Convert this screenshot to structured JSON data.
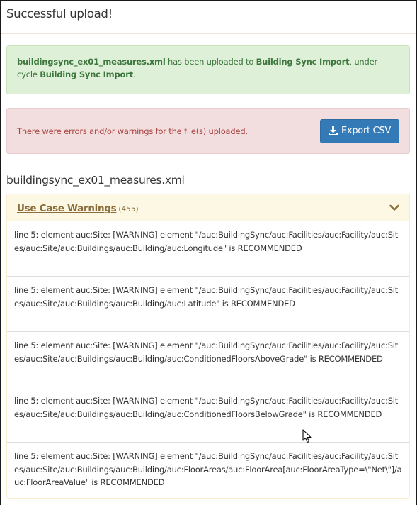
{
  "header": {
    "title": "Successful upload!"
  },
  "success_alert": {
    "file": "buildingsync_ex01_measures.xml",
    "text1": " has been uploaded to ",
    "dataset": "Building Sync Import",
    "text2": ", under cycle ",
    "cycle": "Building Sync Import",
    "text3": "."
  },
  "error_alert": {
    "message": "There were errors and/or warnings for the file(s) uploaded.",
    "export_label": "Export CSV"
  },
  "file_heading": "buildingsync_ex01_measures.xml",
  "panel": {
    "title": "Use Case Warnings",
    "count": "(455)",
    "warnings": [
      "line 5: element auc:Site: [WARNING] element \"/auc:BuildingSync/auc:Facilities/auc:Facility/auc:Sites/auc:Site/auc:Buildings/auc:Building/auc:Longitude\" is RECOMMENDED",
      "line 5: element auc:Site: [WARNING] element \"/auc:BuildingSync/auc:Facilities/auc:Facility/auc:Sites/auc:Site/auc:Buildings/auc:Building/auc:Latitude\" is RECOMMENDED",
      "line 5: element auc:Site: [WARNING] element \"/auc:BuildingSync/auc:Facilities/auc:Facility/auc:Sites/auc:Site/auc:Buildings/auc:Building/auc:ConditionedFloorsAboveGrade\" is RECOMMENDED",
      "line 5: element auc:Site: [WARNING] element \"/auc:BuildingSync/auc:Facilities/auc:Facility/auc:Sites/auc:Site/auc:Buildings/auc:Building/auc:ConditionedFloorsBelowGrade\" is RECOMMENDED",
      "line 5: element auc:Site: [WARNING] element \"/auc:BuildingSync/auc:Facilities/auc:Facility/auc:Sites/auc:Site/auc:Buildings/auc:Building/auc:FloorAreas/auc:FloorArea[auc:FloorAreaType=\\\"Net\\\"]/auc:FloorAreaValue\" is RECOMMENDED"
    ]
  },
  "icons": {
    "export": "download-icon",
    "toggle": "chevron-down-icon",
    "pointer": "mouse-cursor-icon"
  },
  "colors": {
    "success_bg": "#dff0d8",
    "success_text": "#3c763d",
    "danger_bg": "#f2dede",
    "danger_text": "#a94442",
    "primary": "#337ab7",
    "warning_bg": "#fcf8e3",
    "warning_text": "#8a6d3b"
  }
}
